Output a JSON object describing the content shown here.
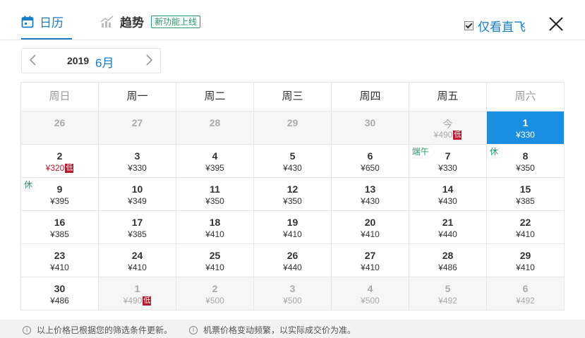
{
  "tabs": {
    "calendar_label": "日历",
    "trend_label": "趋势",
    "trend_badge": "新功能上线"
  },
  "direct_only": {
    "label": "仅看直飞",
    "checked": true
  },
  "month_nav": {
    "year": "2019",
    "month": "6月"
  },
  "weekdays": [
    "周日",
    "周一",
    "周二",
    "周三",
    "周四",
    "周五",
    "周六"
  ],
  "low_label": "低",
  "weeks": [
    [
      {
        "d": "26",
        "p": "",
        "other": true
      },
      {
        "d": "27",
        "p": "",
        "other": true
      },
      {
        "d": "28",
        "p": "",
        "other": true
      },
      {
        "d": "29",
        "p": "",
        "other": true
      },
      {
        "d": "30",
        "p": "",
        "other": true
      },
      {
        "d": "今",
        "p": "¥490",
        "other": true,
        "today": true,
        "low": true
      },
      {
        "d": "1",
        "p": "¥330",
        "selected": true
      }
    ],
    [
      {
        "d": "2",
        "p": "¥320",
        "low": true
      },
      {
        "d": "3",
        "p": "¥330"
      },
      {
        "d": "4",
        "p": "¥395"
      },
      {
        "d": "5",
        "p": "¥430"
      },
      {
        "d": "6",
        "p": "¥650"
      },
      {
        "d": "7",
        "p": "¥330",
        "tag": "端午"
      },
      {
        "d": "8",
        "p": "¥350",
        "tag": "休"
      }
    ],
    [
      {
        "d": "9",
        "p": "¥395",
        "tag": "休"
      },
      {
        "d": "10",
        "p": "¥349"
      },
      {
        "d": "11",
        "p": "¥350"
      },
      {
        "d": "12",
        "p": "¥350"
      },
      {
        "d": "13",
        "p": "¥430"
      },
      {
        "d": "14",
        "p": "¥430"
      },
      {
        "d": "15",
        "p": "¥385"
      }
    ],
    [
      {
        "d": "16",
        "p": "¥385"
      },
      {
        "d": "17",
        "p": "¥385"
      },
      {
        "d": "18",
        "p": "¥410"
      },
      {
        "d": "19",
        "p": "¥410"
      },
      {
        "d": "20",
        "p": "¥410"
      },
      {
        "d": "21",
        "p": "¥440"
      },
      {
        "d": "22",
        "p": "¥410"
      }
    ],
    [
      {
        "d": "23",
        "p": "¥410"
      },
      {
        "d": "24",
        "p": "¥410"
      },
      {
        "d": "25",
        "p": "¥410"
      },
      {
        "d": "26",
        "p": "¥440"
      },
      {
        "d": "27",
        "p": "¥410"
      },
      {
        "d": "28",
        "p": "¥486"
      },
      {
        "d": "29",
        "p": "¥410"
      }
    ],
    [
      {
        "d": "30",
        "p": "¥486"
      },
      {
        "d": "1",
        "p": "¥490",
        "other": true,
        "low": true
      },
      {
        "d": "2",
        "p": "¥500",
        "other": true
      },
      {
        "d": "3",
        "p": "¥500",
        "other": true
      },
      {
        "d": "4",
        "p": "¥500",
        "other": true
      },
      {
        "d": "5",
        "p": "¥492",
        "other": true
      },
      {
        "d": "6",
        "p": "¥492",
        "other": true
      }
    ]
  ],
  "footer": {
    "note1": "以上价格已根据您的筛选条件更新。",
    "note2": "机票价格变动频繁，以实际成交价为准。"
  },
  "colors": {
    "accent": "#1a7ec5",
    "selected": "#1a8ee1",
    "low": "#b01e2e",
    "holiday": "#2a9a6a"
  }
}
